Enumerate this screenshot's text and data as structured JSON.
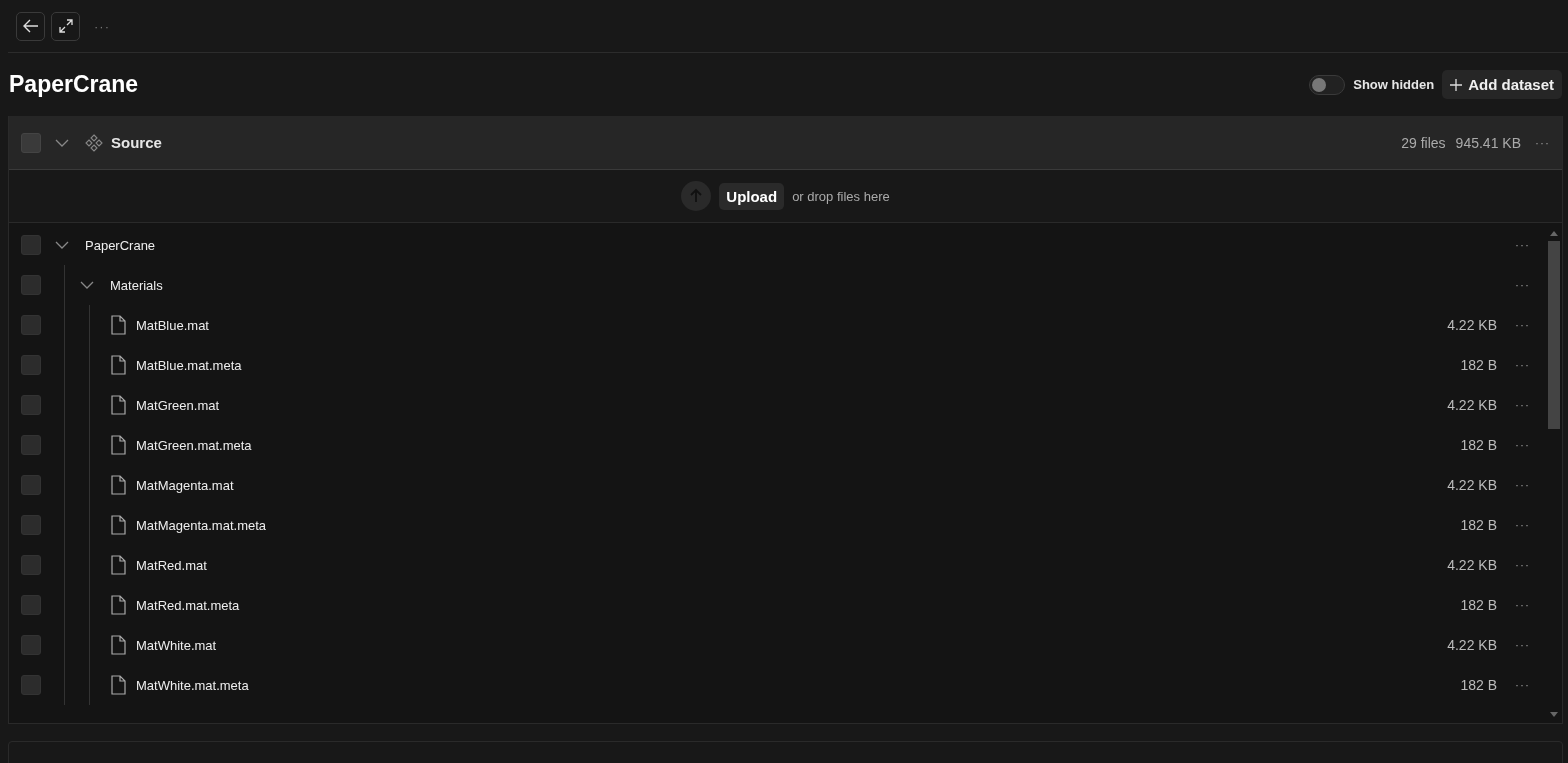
{
  "toolbar": {
    "more": "···"
  },
  "title": "PaperCrane",
  "show_hidden": {
    "label": "Show hidden",
    "on": false
  },
  "add_button": {
    "label": "Add dataset"
  },
  "dataset": {
    "name": "Source",
    "checked": false,
    "expanded": true,
    "file_count": "29 files",
    "size": "945.41 KB",
    "more": "···"
  },
  "upload": {
    "button": "Upload",
    "hint": "or drop files here"
  },
  "tree": [
    {
      "kind": "folder",
      "name": "PaperCrane",
      "checked": false,
      "expanded": true,
      "more": "···",
      "children": [
        {
          "kind": "folder",
          "name": "Materials",
          "checked": false,
          "expanded": true,
          "more": "···",
          "children": [
            {
              "kind": "file",
              "name": "MatBlue.mat",
              "size": "4.22 KB",
              "checked": false,
              "more": "···"
            },
            {
              "kind": "file",
              "name": "MatBlue.mat.meta",
              "size": "182 B",
              "checked": false,
              "more": "···"
            },
            {
              "kind": "file",
              "name": "MatGreen.mat",
              "size": "4.22 KB",
              "checked": false,
              "more": "···"
            },
            {
              "kind": "file",
              "name": "MatGreen.mat.meta",
              "size": "182 B",
              "checked": false,
              "more": "···"
            },
            {
              "kind": "file",
              "name": "MatMagenta.mat",
              "size": "4.22 KB",
              "checked": false,
              "more": "···"
            },
            {
              "kind": "file",
              "name": "MatMagenta.mat.meta",
              "size": "182 B",
              "checked": false,
              "more": "···"
            },
            {
              "kind": "file",
              "name": "MatRed.mat",
              "size": "4.22 KB",
              "checked": false,
              "more": "···"
            },
            {
              "kind": "file",
              "name": "MatRed.mat.meta",
              "size": "182 B",
              "checked": false,
              "more": "···"
            },
            {
              "kind": "file",
              "name": "MatWhite.mat",
              "size": "4.22 KB",
              "checked": false,
              "more": "···"
            },
            {
              "kind": "file",
              "name": "MatWhite.mat.meta",
              "size": "182 B",
              "checked": false,
              "more": "···"
            }
          ]
        }
      ]
    }
  ]
}
